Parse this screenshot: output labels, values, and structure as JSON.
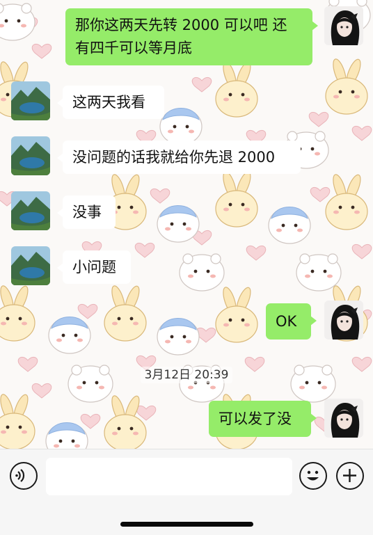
{
  "messages": [
    {
      "side": "out",
      "line1": "那你这两天先转 2000 可以吧 还",
      "line2": "有四千可以等月底"
    },
    {
      "side": "in",
      "text": "这两天我看"
    },
    {
      "side": "in",
      "text": "没问题的话我就给你先退 2000"
    },
    {
      "side": "in",
      "text": "没事"
    },
    {
      "side": "in",
      "text": "小问题"
    },
    {
      "side": "out",
      "text": "OK"
    },
    {
      "side": "out",
      "text": "可以发了没"
    }
  ],
  "timestamp": "3月12日 20:39",
  "input_bar": {
    "voice_icon": "voice-icon",
    "emoji_icon": "emoji-icon",
    "plus_icon": "plus-icon",
    "input_value": ""
  },
  "colors": {
    "outgoing_bubble": "#95ec69",
    "incoming_bubble": "#ffffff",
    "input_bar_bg": "#f6f6f6"
  }
}
